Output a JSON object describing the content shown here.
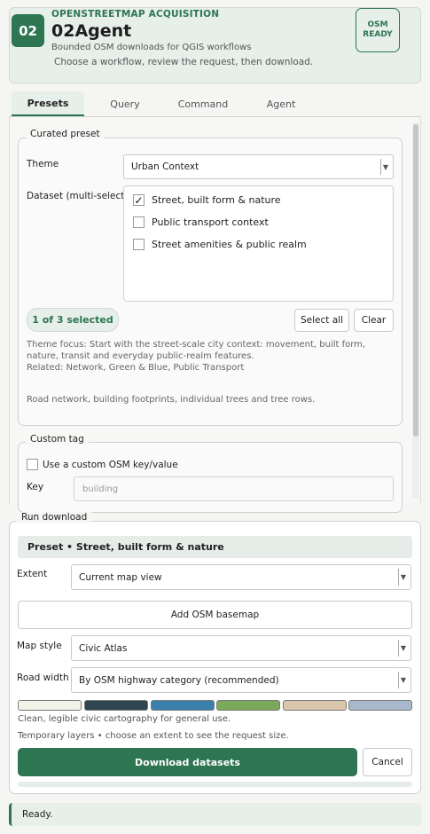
{
  "header": {
    "badge": "02",
    "kicker": "OPENSTREETMAP ACQUISITION",
    "title": "02Agent",
    "subtitle": "Bounded OSM downloads for QGIS workflows",
    "instruction": "Choose a workflow, review the request, then download.",
    "status_badge": "OSM\nREADY"
  },
  "tabs": [
    {
      "label": "Presets",
      "active": true
    },
    {
      "label": "Query",
      "active": false
    },
    {
      "label": "Command",
      "active": false
    },
    {
      "label": "Agent",
      "active": false
    }
  ],
  "curated": {
    "legend": "Curated preset",
    "theme_label": "Theme",
    "theme_value": "Urban Context",
    "dataset_label": "Dataset (multi-select)",
    "datasets": [
      {
        "label": "Street, built form & nature",
        "checked": true
      },
      {
        "label": "Public transport context",
        "checked": false
      },
      {
        "label": "Street amenities & public realm",
        "checked": false
      }
    ],
    "selected_count": "1 of 3 selected",
    "select_all": "Select all",
    "clear": "Clear",
    "theme_focus": "Theme focus: Start with the street-scale city context: movement, built form, nature, transit and everyday public-realm features.",
    "related": "Related: Network, Green & Blue, Public Transport",
    "dataset_description": "Road network, building footprints, individual trees and tree rows."
  },
  "custom_tag": {
    "legend": "Custom tag",
    "checkbox_label": "Use a custom OSM key/value",
    "checked": false,
    "key_label": "Key",
    "key_placeholder": "building"
  },
  "run": {
    "legend": "Run download",
    "preset_bar": "Preset  •  Street, built form & nature",
    "extent_label": "Extent",
    "extent_value": "Current map view",
    "basemap_button": "Add OSM basemap",
    "style_label": "Map style",
    "style_value": "Civic Atlas",
    "road_label": "Road width",
    "road_value": "By OSM highway category (recommended)",
    "palette": [
      "#f4f3ea",
      "#2f4550",
      "#3b7fac",
      "#7aa95c",
      "#d9c6ad",
      "#a7b9cb"
    ],
    "style_description": "Clean, legible civic cartography for general use.",
    "temp_layers": "Temporary layers  •  choose an extent to see the request size.",
    "download_button": "Download datasets",
    "cancel_button": "Cancel",
    "progress": 0
  },
  "status": {
    "text": "Ready."
  },
  "icons": {
    "dropdown": "chevron-down-icon",
    "checkmark": "checkmark-icon"
  }
}
